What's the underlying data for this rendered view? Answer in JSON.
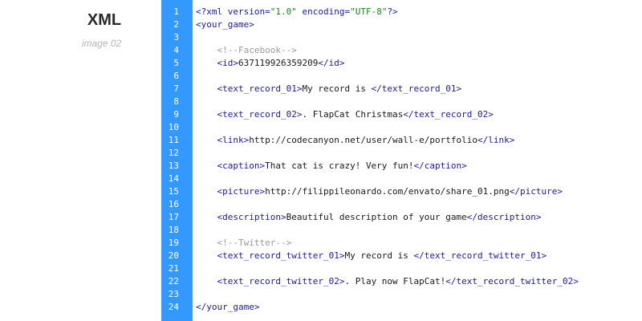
{
  "sidebar": {
    "title": "XML",
    "subtitle": "image 02"
  },
  "colors": {
    "gutter": "#3399ff",
    "tag": "#1a1aa6",
    "string": "#1a8a1a",
    "comment": "#9a9a9a"
  },
  "editor": {
    "line_numbers": [
      "1",
      "2",
      "3",
      "4",
      "5",
      "6",
      "7",
      "8",
      "9",
      "10",
      "11",
      "12",
      "13",
      "14",
      "15",
      "16",
      "17",
      "18",
      "19",
      "20",
      "21",
      "22",
      "23",
      "24"
    ],
    "lines": [
      [
        {
          "t": "tag",
          "v": "<?xml version="
        },
        {
          "t": "str",
          "v": "\"1.0\""
        },
        {
          "t": "tag",
          "v": " encoding="
        },
        {
          "t": "str",
          "v": "\"UTF-8\""
        },
        {
          "t": "tag",
          "v": "?>"
        }
      ],
      [
        {
          "t": "tag",
          "v": "<your_game>"
        }
      ],
      [],
      [
        {
          "t": "cmt",
          "v": "    <!--Facebook-->"
        }
      ],
      [
        {
          "t": "txt",
          "v": "    "
        },
        {
          "t": "tag",
          "v": "<id>"
        },
        {
          "t": "txt",
          "v": "637119926359209"
        },
        {
          "t": "tag",
          "v": "</id>"
        }
      ],
      [],
      [
        {
          "t": "txt",
          "v": "    "
        },
        {
          "t": "tag",
          "v": "<text_record_01>"
        },
        {
          "t": "txt",
          "v": "My record is "
        },
        {
          "t": "tag",
          "v": "</text_record_01>"
        }
      ],
      [],
      [
        {
          "t": "txt",
          "v": "    "
        },
        {
          "t": "tag",
          "v": "<text_record_02>"
        },
        {
          "t": "txt",
          "v": ". FlapCat Christmas"
        },
        {
          "t": "tag",
          "v": "</text_record_02>"
        }
      ],
      [],
      [
        {
          "t": "txt",
          "v": "    "
        },
        {
          "t": "tag",
          "v": "<link>"
        },
        {
          "t": "txt",
          "v": "http://codecanyon.net/user/wall-e/portfolio"
        },
        {
          "t": "tag",
          "v": "</link>"
        }
      ],
      [],
      [
        {
          "t": "txt",
          "v": "    "
        },
        {
          "t": "tag",
          "v": "<caption>"
        },
        {
          "t": "txt",
          "v": "That cat is crazy! Very fun!"
        },
        {
          "t": "tag",
          "v": "</caption>"
        }
      ],
      [],
      [
        {
          "t": "txt",
          "v": "    "
        },
        {
          "t": "tag",
          "v": "<picture>"
        },
        {
          "t": "txt",
          "v": "http://filippileonardo.com/envato/share_01.png"
        },
        {
          "t": "tag",
          "v": "</picture>"
        }
      ],
      [],
      [
        {
          "t": "txt",
          "v": "    "
        },
        {
          "t": "tag",
          "v": "<description>"
        },
        {
          "t": "txt",
          "v": "Beautiful description of your game"
        },
        {
          "t": "tag",
          "v": "</description>"
        }
      ],
      [],
      [
        {
          "t": "cmt",
          "v": "    <!--Twitter-->"
        }
      ],
      [
        {
          "t": "txt",
          "v": "    "
        },
        {
          "t": "tag",
          "v": "<text_record_twitter_01>"
        },
        {
          "t": "txt",
          "v": "My record is "
        },
        {
          "t": "tag",
          "v": "</text_record_twitter_01>"
        }
      ],
      [],
      [
        {
          "t": "txt",
          "v": "    "
        },
        {
          "t": "tag",
          "v": "<text_record_twitter_02>"
        },
        {
          "t": "txt",
          "v": ". Play now FlapCat!"
        },
        {
          "t": "tag",
          "v": "</text_record_twitter_02>"
        }
      ],
      [],
      [
        {
          "t": "tag",
          "v": "</your_game>"
        }
      ]
    ]
  }
}
